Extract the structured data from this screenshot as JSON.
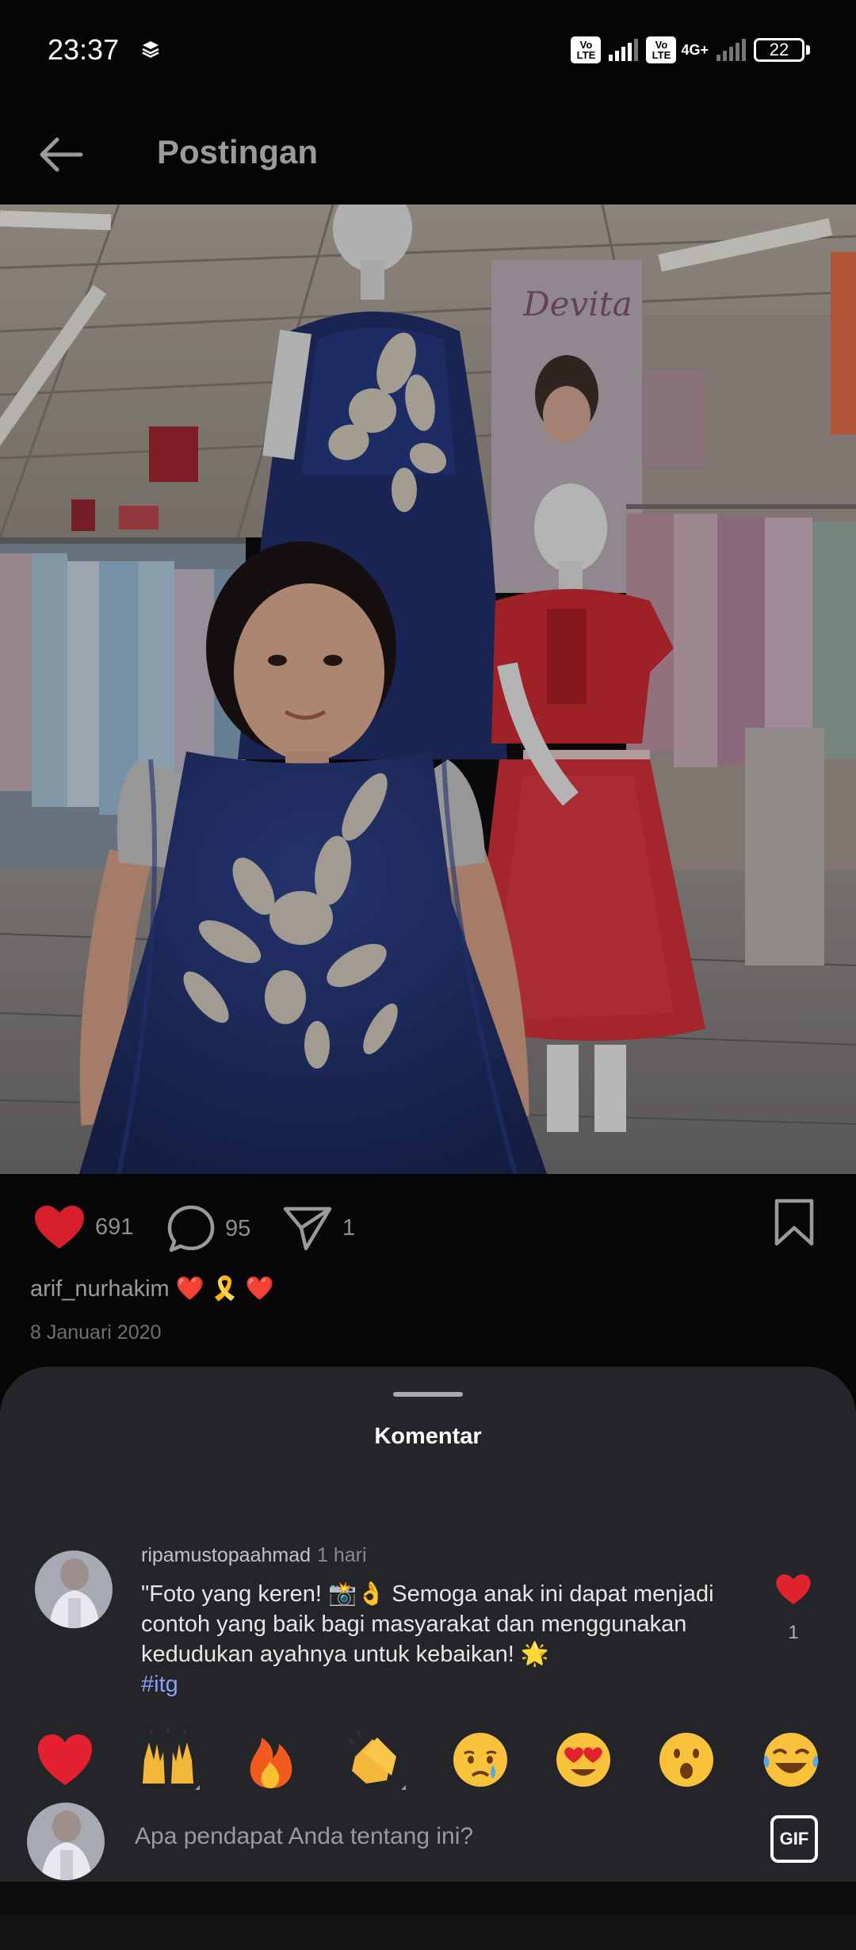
{
  "status_bar": {
    "time": "23:37",
    "sim1": "Vo\nLTE",
    "sim2": "Vo\nLTE",
    "network": "4G+",
    "battery": "22",
    "icons": [
      "layers-icon",
      "signal-icon",
      "battery-icon"
    ]
  },
  "header": {
    "title": "Postingan",
    "back_icon": "arrow-left-icon"
  },
  "post": {
    "likes": "691",
    "comments": "95",
    "shares": "1",
    "author": "arif_nurhakim",
    "author_emojis": [
      "❤️",
      "🎗️",
      "❤️"
    ],
    "date": "8 Januari 2020"
  },
  "sheet": {
    "title": "Komentar",
    "comment": {
      "user": "ripamustopaahmad",
      "time": "1 hari",
      "text": "\"Foto yang keren! 📸👌 Semoga anak ini dapat menjadi contoh yang baik bagi masyarakat dan menggunakan kedudukan ayahnya untuk kebaikan! 🌟",
      "hashtag": "#itg",
      "likes": "1"
    },
    "emojis": [
      "❤️",
      "🙌",
      "🔥",
      "👏",
      "😢",
      "😍",
      "😮",
      "😂"
    ],
    "input_placeholder": "Apa pendapat Anda tentang ini?",
    "gif_label": "GIF"
  },
  "colors": {
    "background": "#0b0b0c",
    "sheet": "#232528",
    "heart": "#e0242f",
    "hashtag": "#8c9dfc"
  }
}
